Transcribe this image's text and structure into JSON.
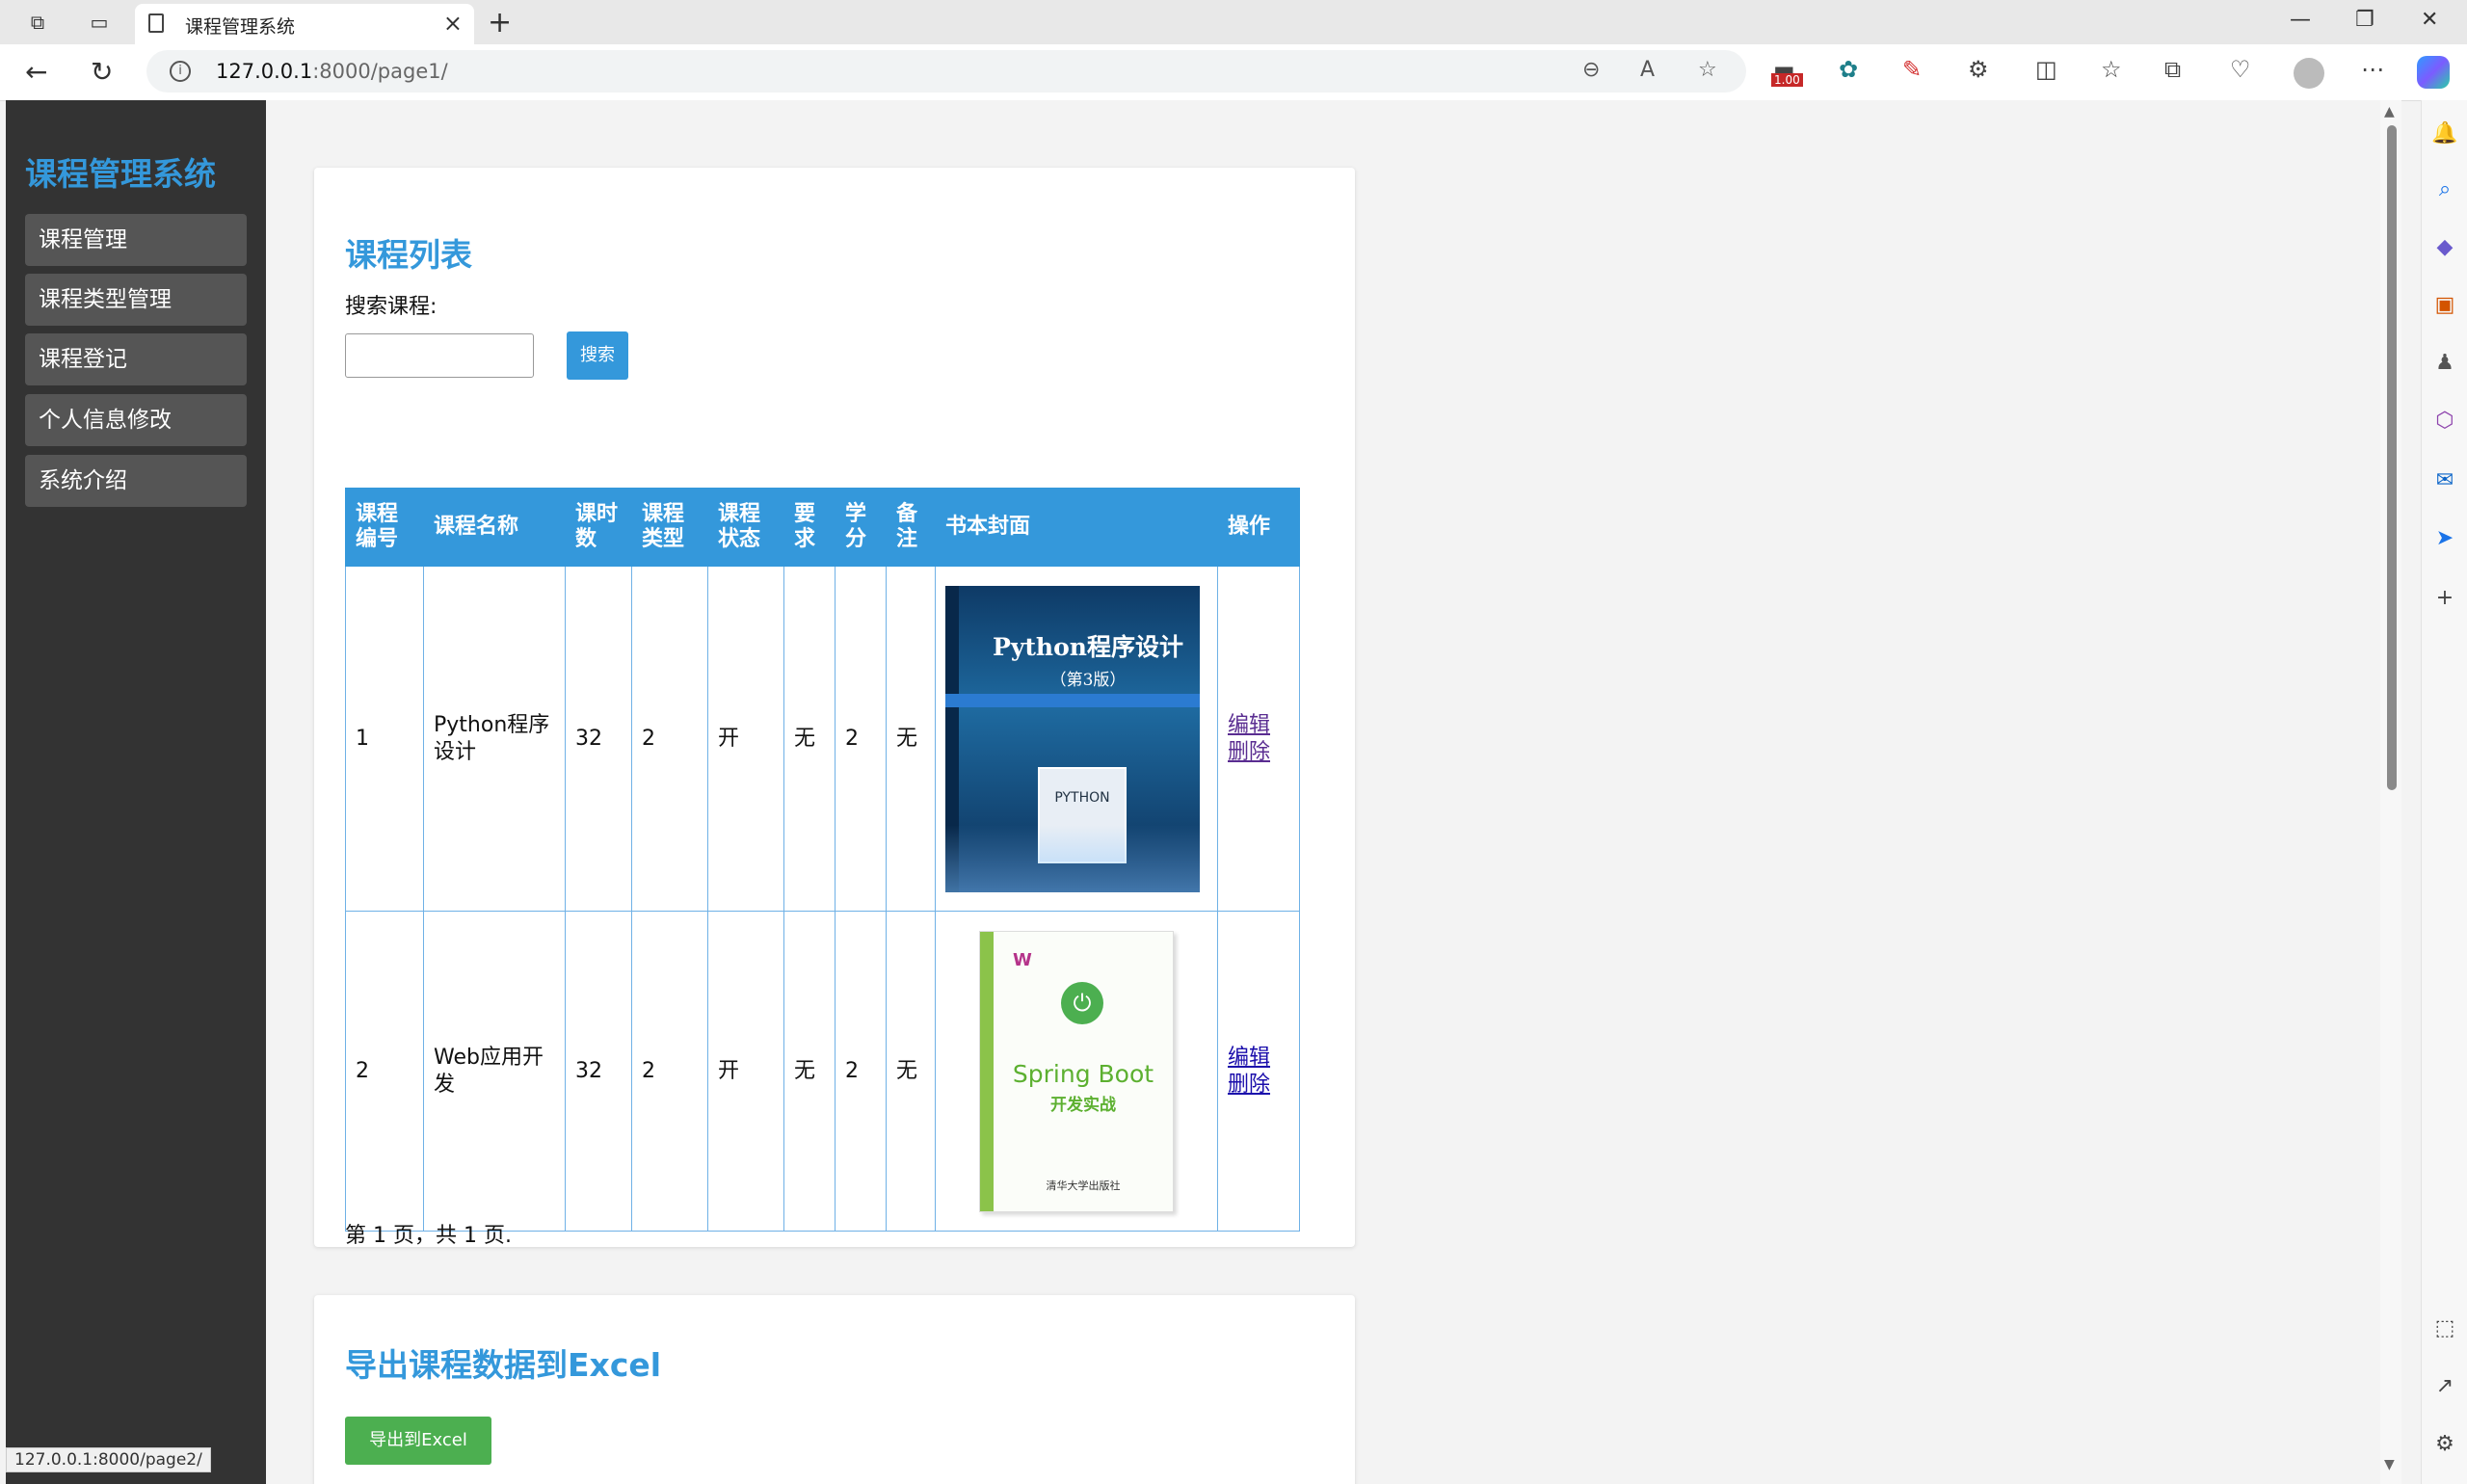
{
  "browser": {
    "tab_title": "课程管理系统",
    "url_host": "127.0.0.1",
    "url_rest": ":8000/page1/",
    "extension_badge": "1.00",
    "status_url": "127.0.0.1:8000/page2/"
  },
  "sidebar": {
    "brand": "课程管理系统",
    "items": [
      {
        "label": "课程管理"
      },
      {
        "label": "课程类型管理"
      },
      {
        "label": "课程登记"
      },
      {
        "label": "个人信息修改"
      },
      {
        "label": "系统介绍"
      }
    ]
  },
  "course_list": {
    "title": "课程列表",
    "search_label": "搜索课程:",
    "search_value": "",
    "search_button": "搜索",
    "columns": [
      "课程编号",
      "课程名称",
      "课时数",
      "课程类型",
      "课程状态",
      "要求",
      "学分",
      "备注",
      "书本封面",
      "操作"
    ],
    "rows": [
      {
        "id": "1",
        "name": "Python程序设计",
        "hours": "32",
        "type": "2",
        "status": "开",
        "requirement": "无",
        "credit": "2",
        "remark": "无",
        "cover": {
          "title": "Python程序设计",
          "edition": "（第3版）",
          "inner": "PYTHON"
        },
        "edit": "编辑",
        "delete": "删除"
      },
      {
        "id": "2",
        "name": "Web应用开发",
        "hours": "32",
        "type": "2",
        "status": "开",
        "requirement": "无",
        "credit": "2",
        "remark": "无",
        "cover": {
          "title": "Spring Boot",
          "subtitle": "开发实战",
          "publisher": "清华大学出版社"
        },
        "edit": "编辑",
        "delete": "删除"
      }
    ],
    "pagination": "第 1 页，共 1 页."
  },
  "export": {
    "title": "导出课程数据到Excel",
    "button": "导出到Excel"
  },
  "colors": {
    "accent": "#3498db",
    "sidebar_bg": "#333333",
    "nav_item_bg": "#555555",
    "export_green": "#4caf50"
  }
}
